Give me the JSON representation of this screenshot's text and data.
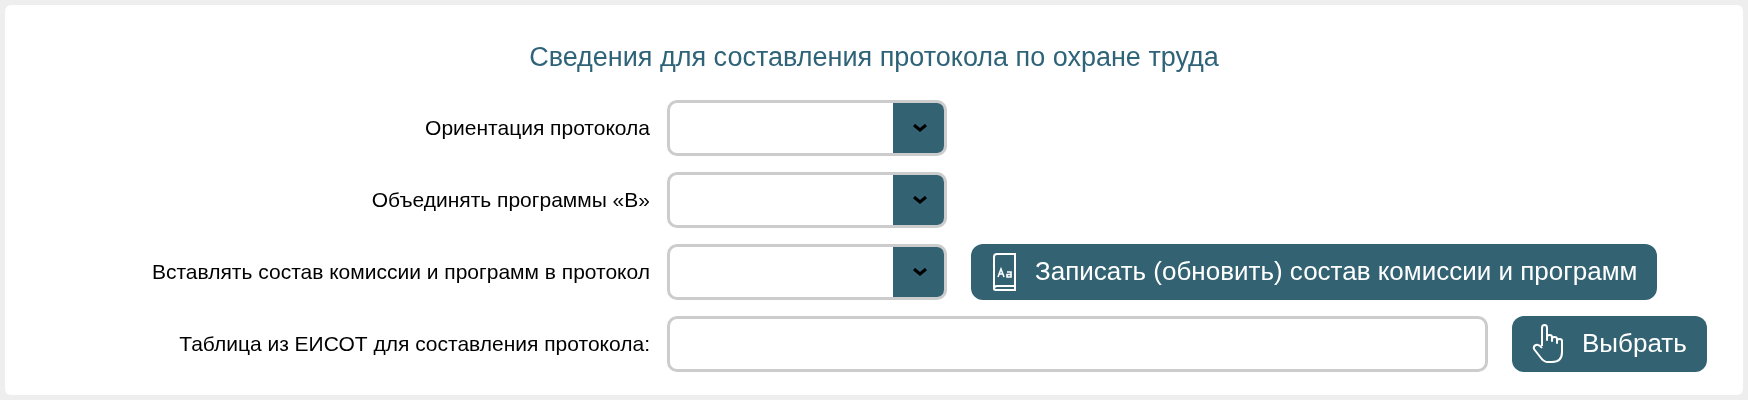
{
  "title": "Сведения для составления протокола по охране труда",
  "rows": [
    {
      "label": "Ориентация протокола",
      "kind": "select"
    },
    {
      "label": "Объединять программы «В»",
      "kind": "select"
    },
    {
      "label": "Вставлять состав комиссии и программ в протокол",
      "kind": "select",
      "action": {
        "label": "Записать (обновить) состав комиссии и программ",
        "kind": "save"
      }
    },
    {
      "label": "Таблица из ЕИСОТ для составления протокола:",
      "kind": "text",
      "action": {
        "label": "Выбрать",
        "kind": "choose"
      }
    }
  ]
}
